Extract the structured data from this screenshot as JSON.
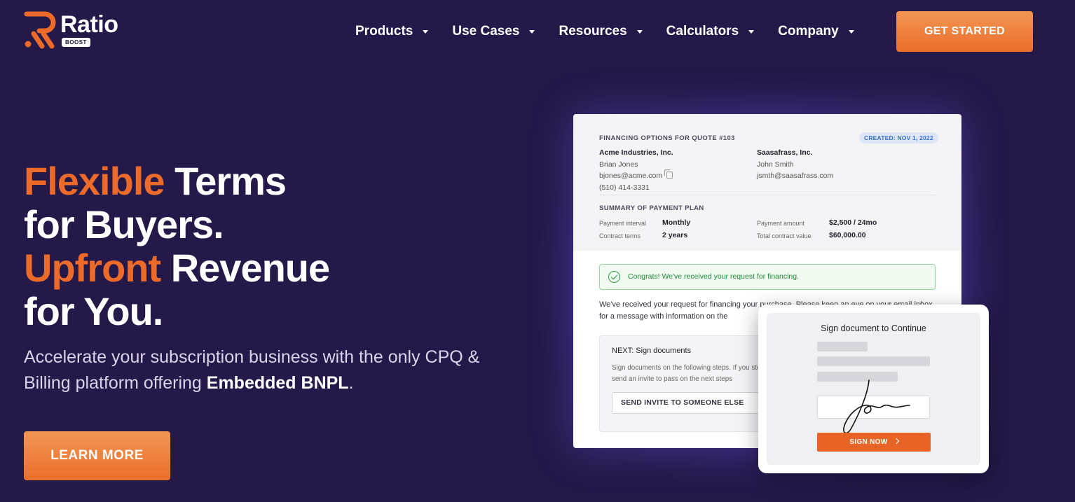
{
  "header": {
    "logo": {
      "word": "Ratio",
      "badge": "BOOST"
    },
    "nav": [
      {
        "label": "Products"
      },
      {
        "label": "Use Cases"
      },
      {
        "label": "Resources"
      },
      {
        "label": "Calculators"
      },
      {
        "label": "Company"
      }
    ],
    "cta_label": "GET STARTED"
  },
  "hero": {
    "line1_accent": "Flexible",
    "line1_rest": " Terms",
    "line2": "for Buyers.",
    "line3_accent": "Upfront",
    "line3_rest": " Revenue",
    "line4": "for You.",
    "sub_text": "Accelerate your subscription business with the only CPQ & Billing platform offering ",
    "sub_bold": "Embedded BNPL",
    "sub_end": ".",
    "cta_label": "LEARN MORE"
  },
  "card": {
    "quote_title": "FINANCING OPTIONS FOR QUOTE #103",
    "created_badge": "CREATED: NOV 1, 2022",
    "party_a": {
      "company": "Acme Industries, Inc.",
      "contact": "Brian Jones",
      "email": "bjones@acme.com",
      "phone": "(510) 414-3331"
    },
    "party_b": {
      "company": "Saasafrass, Inc.",
      "contact": "John Smith",
      "email": "jsmth@saasafrass.com"
    },
    "summary_title": "SUMMARY OF PAYMENT PLAN",
    "terms": {
      "interval_label": "Payment interval",
      "interval_value": "Monthly",
      "contract_label": "Contract terms",
      "contract_value": "2 years",
      "amount_label": "Payment amount",
      "amount_value": "$2,500 / 24mo",
      "total_label": "Total contract value",
      "total_value": "$60,000.00"
    },
    "success_text": "Congrats! We've received your request for financing.",
    "message": "We've received your request for financing your purchase. Please keep an eye on your email inbox for a message with information on the",
    "next_title": "NEXT: Sign documents",
    "next_desc": "Sign documents on the following steps. If you step, send an invite to pass on the next steps",
    "invite_label": "SEND INVITE TO SOMEONE ELSE"
  },
  "sign_popup": {
    "title": "Sign document to Continue",
    "button_label": "SIGN NOW"
  },
  "colors": {
    "background": "#241949",
    "accent": "#ec6b2a",
    "button_gradient_top": "#f29552",
    "button_gradient_bottom": "#ea6f2b"
  }
}
